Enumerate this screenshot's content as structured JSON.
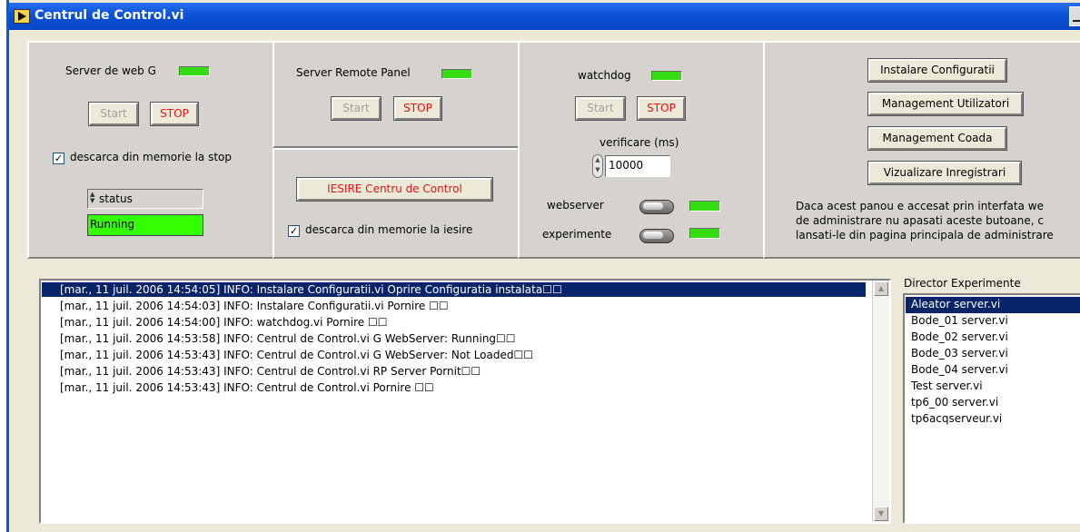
{
  "window": {
    "title": "Centrul de Control.vi"
  },
  "web_server": {
    "label": "Server de web G",
    "start_label": "Start",
    "stop_label": "STOP",
    "checkbox_label": "descarca din memorie la stop",
    "checkbox_checked": true,
    "status_ring": "status",
    "status_value": "Running"
  },
  "remote_panel": {
    "label": "Server Remote Panel",
    "start_label": "Start",
    "stop_label": "STOP"
  },
  "exit_panel": {
    "exit_label": "IESIRE Centru de Control",
    "checkbox_label": "descarca din memorie la iesire",
    "checkbox_checked": true
  },
  "watchdog": {
    "label": "watchdog",
    "start_label": "Start",
    "stop_label": "STOP",
    "interval_label": "verificare (ms)",
    "interval_value": "10000",
    "webserver_label": "webserver",
    "experiments_label": "experimente"
  },
  "admin": {
    "buttons": [
      "Instalare Configuratii",
      "Management Utilizatori",
      "Management Coada",
      "Vizualizare Inregistrari"
    ],
    "note_lines": [
      "Daca acest panou e accesat prin interfata we",
      "de administrare nu apasati aceste butoane, c",
      "lansati-le din pagina principala de administrare"
    ]
  },
  "log": {
    "entries": [
      "[mar., 11 juil. 2006 14:54:05] INFO: Instalare Configuratii.vi Oprire Configuratia instalata☐☐",
      "[mar., 11 juil. 2006 14:54:03] INFO: Instalare Configuratii.vi Pornire ☐☐",
      "[mar., 11 juil. 2006 14:54:00] INFO: watchdog.vi Pornire ☐☐",
      "[mar., 11 juil. 2006 14:53:58] INFO: Centrul de Control.vi  G WebServer: Running☐☐",
      "[mar., 11 juil. 2006 14:53:43] INFO: Centrul de Control.vi  G WebServer: Not Loaded☐☐",
      "[mar., 11 juil. 2006 14:53:43] INFO: Centrul de Control.vi  RP Server Pornit☐☐",
      "[mar., 11 juil. 2006 14:53:43] INFO: Centrul de Control.vi Pornire ☐☐"
    ],
    "selected_index": 0
  },
  "experiments": {
    "title": "Director Experimente",
    "items": [
      "Aleator server.vi",
      "Bode_01 server.vi",
      "Bode_02 server.vi",
      "Bode_03 server.vi",
      "Bode_04 server.vi",
      "Test server.vi",
      "tp6_00 server.vi",
      "tp6acqserveur.vi"
    ],
    "selected_index": 0
  },
  "colors": {
    "led_on": "#33dd11",
    "stop_text": "#ee1111",
    "selection": "#0a246a",
    "running_bg": "#33ff00"
  }
}
